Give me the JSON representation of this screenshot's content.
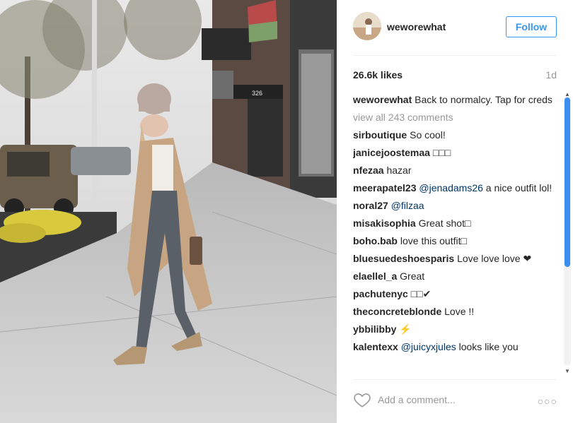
{
  "post": {
    "username": "weworewhat",
    "follow_label": "Follow",
    "likes": "26.6k likes",
    "age": "1d"
  },
  "caption": {
    "username": "weworewhat",
    "text": "Back to normalcy. Tap for creds"
  },
  "view_all": "view all 243 comments",
  "comments": [
    {
      "user": "sirboutique",
      "text": "So cool!"
    },
    {
      "user": "janicejoostemaa",
      "text": "□□□"
    },
    {
      "user": "nfezaa",
      "text": "hazar"
    },
    {
      "user": "meerapatel23",
      "mention": "@jenadams26",
      "text": "a nice outfit lol!"
    },
    {
      "user": "noral27",
      "mention": "@filzaa",
      "text": ""
    },
    {
      "user": "misakisophia",
      "text": "Great shot□"
    },
    {
      "user": "boho.bab",
      "text": "love this outfit□"
    },
    {
      "user": "bluesuedeshoesparis",
      "text": "Love love love ❤"
    },
    {
      "user": "elaellel_a",
      "text": "Great"
    },
    {
      "user": "pachutenyc",
      "text": "□□✔"
    },
    {
      "user": "theconcreteblonde",
      "text": "Love !!"
    },
    {
      "user": "ybbilibby",
      "text": "⚡"
    },
    {
      "user": "kalentexx",
      "mention": "@juicyxjules",
      "text": "looks like you"
    }
  ],
  "add_comment_placeholder": "Add a comment...",
  "more_icon": "ellipsis-icon",
  "heart_icon": "heart-icon",
  "accent_color": "#3897f0"
}
